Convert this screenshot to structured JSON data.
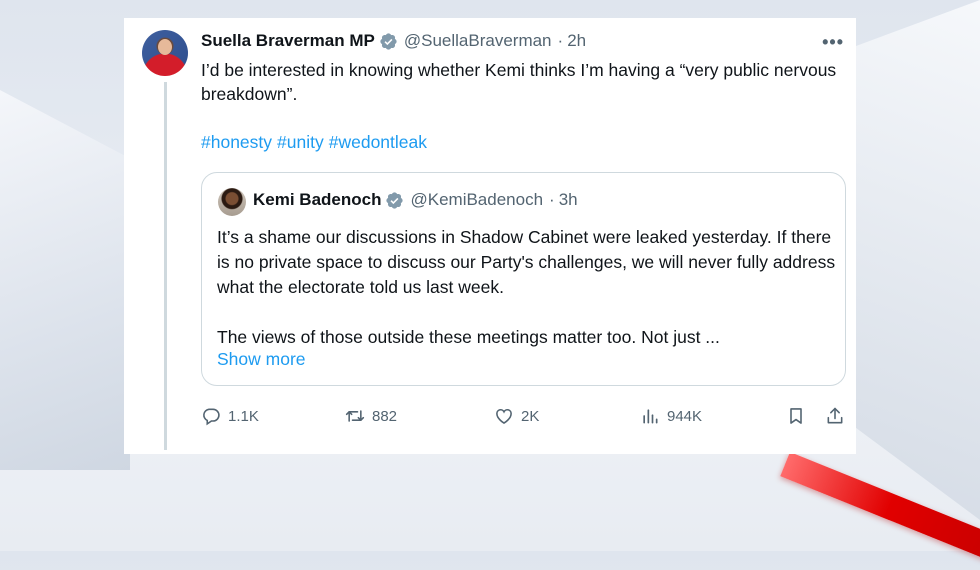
{
  "tweet": {
    "author_name": "Suella Braverman MP",
    "author_handle": "@SuellaBraverman",
    "separator": "·",
    "time": "2h",
    "text": "I’d be interested in knowing whether Kemi thinks I’m having a “very public nervous breakdown”.",
    "hashtags": [
      "#honesty",
      "#unity",
      "#wedontleak"
    ],
    "more_label": "•••"
  },
  "quote": {
    "author_name": "Kemi Badenoch",
    "author_handle": "@KemiBadenoch",
    "separator": "·",
    "time": "3h",
    "paragraph1": "It’s a shame our discussions in Shadow Cabinet were leaked yesterday. If there is no private space to discuss our Party's challenges, we will never fully address what the electorate told us last week.",
    "paragraph2": "The views of those outside these meetings matter too. Not just ...",
    "show_more": "Show more"
  },
  "actions": {
    "replies": "1.1K",
    "reposts": "882",
    "likes": "2K",
    "views": "944K"
  },
  "colors": {
    "link": "#1d9bf0",
    "muted": "#536471",
    "verified": "#829aab",
    "accent_stripe": "#e10000"
  },
  "icons": [
    "reply-icon",
    "repost-icon",
    "like-icon",
    "views-icon",
    "bookmark-icon",
    "share-icon",
    "verified-badge-icon",
    "more-icon"
  ]
}
